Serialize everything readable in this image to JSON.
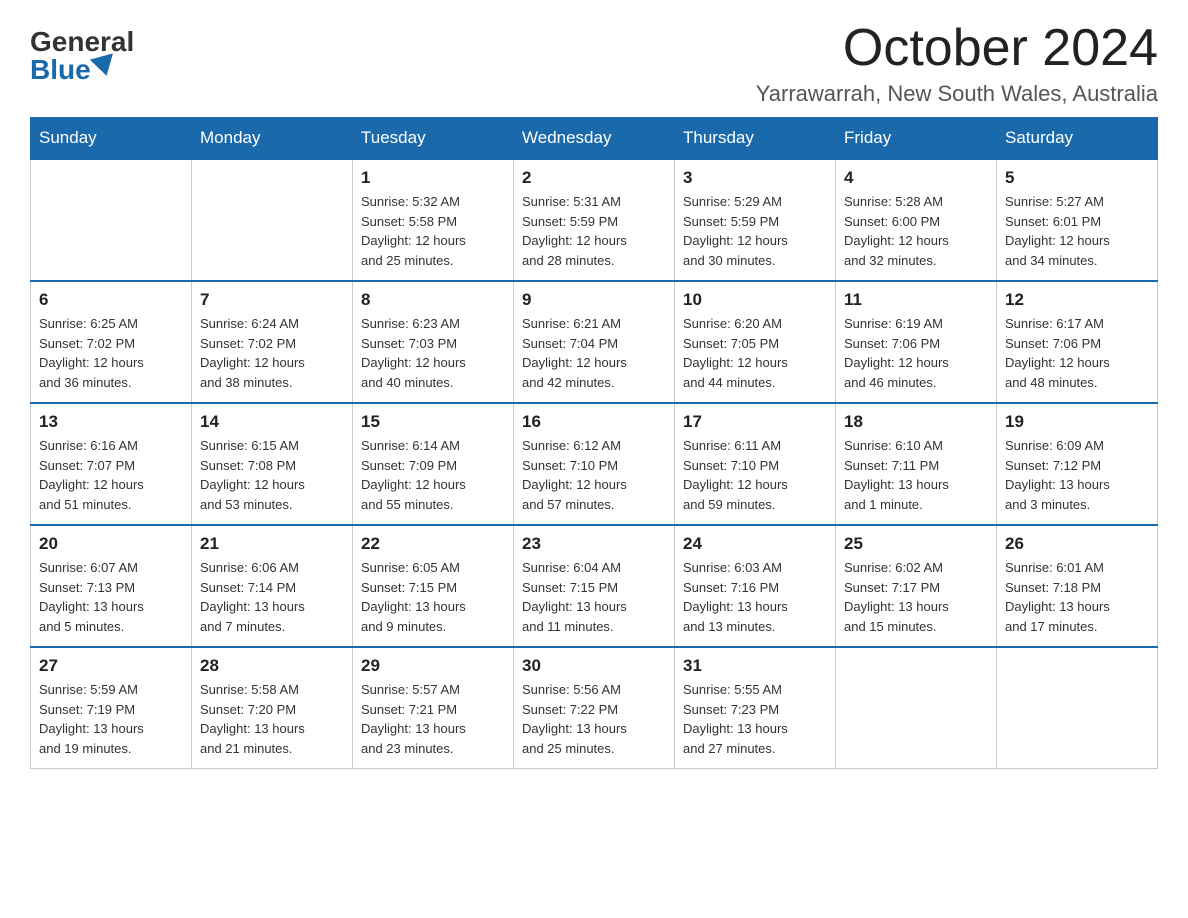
{
  "header": {
    "logo_general": "General",
    "logo_blue": "Blue",
    "month": "October 2024",
    "location": "Yarrawarrah, New South Wales, Australia"
  },
  "weekdays": [
    "Sunday",
    "Monday",
    "Tuesday",
    "Wednesday",
    "Thursday",
    "Friday",
    "Saturday"
  ],
  "weeks": [
    [
      {
        "day": "",
        "info": ""
      },
      {
        "day": "",
        "info": ""
      },
      {
        "day": "1",
        "info": "Sunrise: 5:32 AM\nSunset: 5:58 PM\nDaylight: 12 hours\nand 25 minutes."
      },
      {
        "day": "2",
        "info": "Sunrise: 5:31 AM\nSunset: 5:59 PM\nDaylight: 12 hours\nand 28 minutes."
      },
      {
        "day": "3",
        "info": "Sunrise: 5:29 AM\nSunset: 5:59 PM\nDaylight: 12 hours\nand 30 minutes."
      },
      {
        "day": "4",
        "info": "Sunrise: 5:28 AM\nSunset: 6:00 PM\nDaylight: 12 hours\nand 32 minutes."
      },
      {
        "day": "5",
        "info": "Sunrise: 5:27 AM\nSunset: 6:01 PM\nDaylight: 12 hours\nand 34 minutes."
      }
    ],
    [
      {
        "day": "6",
        "info": "Sunrise: 6:25 AM\nSunset: 7:02 PM\nDaylight: 12 hours\nand 36 minutes."
      },
      {
        "day": "7",
        "info": "Sunrise: 6:24 AM\nSunset: 7:02 PM\nDaylight: 12 hours\nand 38 minutes."
      },
      {
        "day": "8",
        "info": "Sunrise: 6:23 AM\nSunset: 7:03 PM\nDaylight: 12 hours\nand 40 minutes."
      },
      {
        "day": "9",
        "info": "Sunrise: 6:21 AM\nSunset: 7:04 PM\nDaylight: 12 hours\nand 42 minutes."
      },
      {
        "day": "10",
        "info": "Sunrise: 6:20 AM\nSunset: 7:05 PM\nDaylight: 12 hours\nand 44 minutes."
      },
      {
        "day": "11",
        "info": "Sunrise: 6:19 AM\nSunset: 7:06 PM\nDaylight: 12 hours\nand 46 minutes."
      },
      {
        "day": "12",
        "info": "Sunrise: 6:17 AM\nSunset: 7:06 PM\nDaylight: 12 hours\nand 48 minutes."
      }
    ],
    [
      {
        "day": "13",
        "info": "Sunrise: 6:16 AM\nSunset: 7:07 PM\nDaylight: 12 hours\nand 51 minutes."
      },
      {
        "day": "14",
        "info": "Sunrise: 6:15 AM\nSunset: 7:08 PM\nDaylight: 12 hours\nand 53 minutes."
      },
      {
        "day": "15",
        "info": "Sunrise: 6:14 AM\nSunset: 7:09 PM\nDaylight: 12 hours\nand 55 minutes."
      },
      {
        "day": "16",
        "info": "Sunrise: 6:12 AM\nSunset: 7:10 PM\nDaylight: 12 hours\nand 57 minutes."
      },
      {
        "day": "17",
        "info": "Sunrise: 6:11 AM\nSunset: 7:10 PM\nDaylight: 12 hours\nand 59 minutes."
      },
      {
        "day": "18",
        "info": "Sunrise: 6:10 AM\nSunset: 7:11 PM\nDaylight: 13 hours\nand 1 minute."
      },
      {
        "day": "19",
        "info": "Sunrise: 6:09 AM\nSunset: 7:12 PM\nDaylight: 13 hours\nand 3 minutes."
      }
    ],
    [
      {
        "day": "20",
        "info": "Sunrise: 6:07 AM\nSunset: 7:13 PM\nDaylight: 13 hours\nand 5 minutes."
      },
      {
        "day": "21",
        "info": "Sunrise: 6:06 AM\nSunset: 7:14 PM\nDaylight: 13 hours\nand 7 minutes."
      },
      {
        "day": "22",
        "info": "Sunrise: 6:05 AM\nSunset: 7:15 PM\nDaylight: 13 hours\nand 9 minutes."
      },
      {
        "day": "23",
        "info": "Sunrise: 6:04 AM\nSunset: 7:15 PM\nDaylight: 13 hours\nand 11 minutes."
      },
      {
        "day": "24",
        "info": "Sunrise: 6:03 AM\nSunset: 7:16 PM\nDaylight: 13 hours\nand 13 minutes."
      },
      {
        "day": "25",
        "info": "Sunrise: 6:02 AM\nSunset: 7:17 PM\nDaylight: 13 hours\nand 15 minutes."
      },
      {
        "day": "26",
        "info": "Sunrise: 6:01 AM\nSunset: 7:18 PM\nDaylight: 13 hours\nand 17 minutes."
      }
    ],
    [
      {
        "day": "27",
        "info": "Sunrise: 5:59 AM\nSunset: 7:19 PM\nDaylight: 13 hours\nand 19 minutes."
      },
      {
        "day": "28",
        "info": "Sunrise: 5:58 AM\nSunset: 7:20 PM\nDaylight: 13 hours\nand 21 minutes."
      },
      {
        "day": "29",
        "info": "Sunrise: 5:57 AM\nSunset: 7:21 PM\nDaylight: 13 hours\nand 23 minutes."
      },
      {
        "day": "30",
        "info": "Sunrise: 5:56 AM\nSunset: 7:22 PM\nDaylight: 13 hours\nand 25 minutes."
      },
      {
        "day": "31",
        "info": "Sunrise: 5:55 AM\nSunset: 7:23 PM\nDaylight: 13 hours\nand 27 minutes."
      },
      {
        "day": "",
        "info": ""
      },
      {
        "day": "",
        "info": ""
      }
    ]
  ]
}
